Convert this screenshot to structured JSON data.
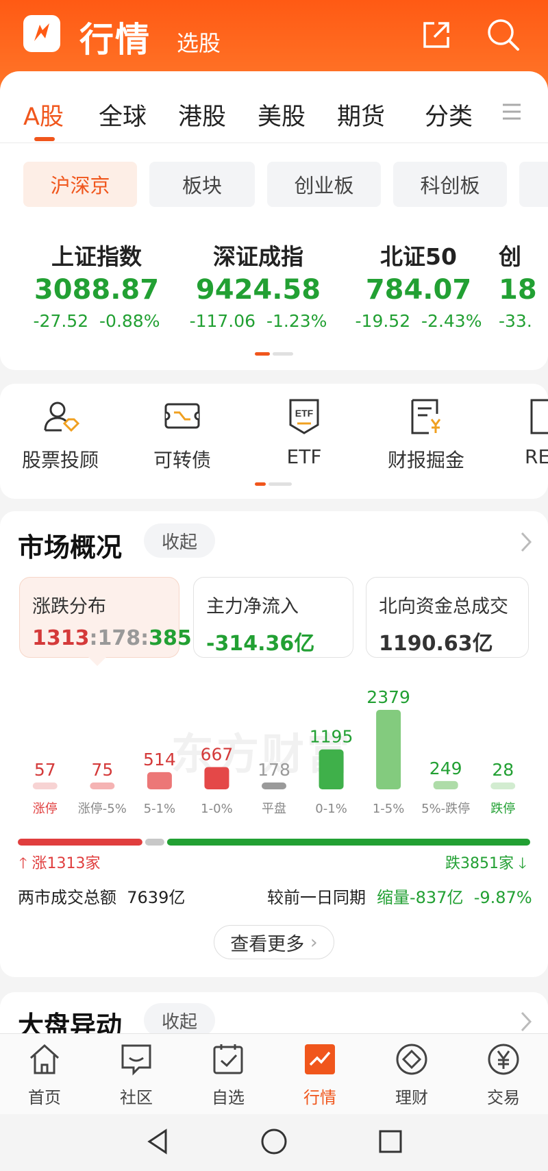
{
  "header": {
    "title": "行情",
    "subtitle": "选股"
  },
  "tabs": [
    {
      "label": "A股",
      "active": true
    },
    {
      "label": "全球"
    },
    {
      "label": "港股"
    },
    {
      "label": "美股"
    },
    {
      "label": "期货"
    },
    {
      "label": "分类"
    }
  ],
  "chips": [
    {
      "label": "沪深京",
      "active": true
    },
    {
      "label": "板块"
    },
    {
      "label": "创业板"
    },
    {
      "label": "科创板"
    }
  ],
  "indices": [
    {
      "name": "上证指数",
      "value": "3088.87",
      "change": "-27.52",
      "pct": "-0.88%"
    },
    {
      "name": "深证成指",
      "value": "9424.58",
      "change": "-117.06",
      "pct": "-1.23%"
    },
    {
      "name": "北证50",
      "value": "784.07",
      "change": "-19.52",
      "pct": "-2.43%"
    },
    {
      "name": "创",
      "value": "18",
      "change": "-33."
    }
  ],
  "tools": [
    {
      "label": "股票投顾",
      "icon": "advisor-icon"
    },
    {
      "label": "可转债",
      "icon": "convertible-bond-icon"
    },
    {
      "label": "ETF",
      "icon": "etf-icon"
    },
    {
      "label": "财报掘金",
      "icon": "financial-report-icon"
    },
    {
      "label": "RE",
      "icon": "reits-icon"
    }
  ],
  "market": {
    "title": "市场概况",
    "collapse_label": "收起",
    "stats": [
      {
        "title": "涨跌分布",
        "value_up": "1313",
        "sep1": ":",
        "value_flat": "178",
        "sep2": ":",
        "value_down": "3851"
      },
      {
        "title": "主力净流入",
        "value": "-314.36亿"
      },
      {
        "title": "北向资金总成交",
        "value": "1190.63亿"
      }
    ],
    "up_label": "涨1313家",
    "down_label": "跌3851家",
    "turnover_label": "两市成交总额",
    "turnover_value": "7639亿",
    "compare_label": "较前一日同期",
    "compare_value": "缩量-837亿",
    "compare_pct": "-9.87%",
    "more_label": "查看更多"
  },
  "watermark": "东方财富",
  "dapan": {
    "title": "大盘异动",
    "collapse_label": "收起"
  },
  "nav": [
    {
      "label": "首页",
      "icon": "home-icon"
    },
    {
      "label": "社区",
      "icon": "community-icon"
    },
    {
      "label": "自选",
      "icon": "watchlist-icon"
    },
    {
      "label": "行情",
      "icon": "market-icon",
      "active": true
    },
    {
      "label": "理财",
      "icon": "wealth-icon"
    },
    {
      "label": "交易",
      "icon": "trade-icon"
    }
  ],
  "colors": {
    "brand": "#f0561c",
    "up": "#e03e3e",
    "down": "#22a033",
    "flat": "#999999"
  },
  "chart_data": {
    "type": "bar",
    "categories": [
      "涨停",
      "涨停-5%",
      "5-1%",
      "1-0%",
      "平盘",
      "0-1%",
      "1-5%",
      "5%-跌停",
      "跌停"
    ],
    "values": [
      57,
      75,
      514,
      667,
      178,
      1195,
      2379,
      249,
      28
    ],
    "bar_colors": [
      "#f7d3d3",
      "#f5b3b3",
      "#ec7777",
      "#e44848",
      "#9a9a9a",
      "#3fb04a",
      "#83cb7e",
      "#aedca8",
      "#d2ecd0"
    ],
    "value_colors": [
      "#d43a3a",
      "#d43a3a",
      "#d43a3a",
      "#d43a3a",
      "#999999",
      "#22a033",
      "#22a033",
      "#22a033",
      "#22a033"
    ],
    "label_colors": [
      "#e03e3e",
      "#888888",
      "#888888",
      "#888888",
      "#888888",
      "#888888",
      "#888888",
      "#888888",
      "#22a033"
    ],
    "ratio": {
      "up": 1313,
      "flat": 178,
      "down": 3851
    }
  }
}
